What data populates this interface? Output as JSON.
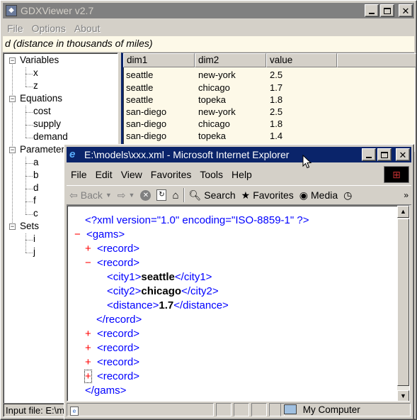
{
  "gdx": {
    "title": "GDXViewer v2.7",
    "menu": [
      "File",
      "Options",
      "About"
    ],
    "symbol_text": "d (distance in thousands of miles)",
    "tree": {
      "groups": [
        {
          "label": "Variables",
          "items": [
            "x",
            "z"
          ]
        },
        {
          "label": "Equations",
          "items": [
            "cost",
            "supply",
            "demand"
          ]
        },
        {
          "label": "Parameters",
          "items": [
            "a",
            "b",
            "d",
            "f",
            "c"
          ]
        },
        {
          "label": "Sets",
          "items": [
            "i",
            "j"
          ]
        }
      ],
      "box_expanded": "−"
    },
    "grid": {
      "headers": [
        "dim1",
        "dim2",
        "value"
      ],
      "rows": [
        [
          "seattle",
          "new-york",
          "2.5"
        ],
        [
          "seattle",
          "chicago",
          "1.7"
        ],
        [
          "seattle",
          "topeka",
          "1.8"
        ],
        [
          "san-diego",
          "new-york",
          "2.5"
        ],
        [
          "san-diego",
          "chicago",
          "1.8"
        ],
        [
          "san-diego",
          "topeka",
          "1.4"
        ]
      ]
    },
    "status_input": "Input file: E:\\m"
  },
  "ie": {
    "title": "E:\\models\\xxx.xml - Microsoft Internet Explorer",
    "menu": [
      "File",
      "Edit",
      "View",
      "Favorites",
      "Tools",
      "Help"
    ],
    "toolbar": {
      "back": "Back",
      "search": "Search",
      "favorites": "Favorites",
      "media": "Media"
    },
    "xml": {
      "decl": "<?xml version=\"1.0\" encoding=\"ISO-8859-1\" ?>",
      "gams_open": "<gams>",
      "record_open": "<record>",
      "city1_open": "<city1>",
      "city1_value": "seattle",
      "city1_close": "</city1>",
      "city2_open": "<city2>",
      "city2_value": "chicago",
      "city2_close": "</city2>",
      "dist_open": "<distance>",
      "dist_value": "1.7",
      "dist_close": "</distance>",
      "record_close": "</record>",
      "gams_close": "</gams>",
      "plus": "+",
      "minus": "−"
    },
    "status_zone": "My Computer"
  },
  "colors": {
    "active_title": "#0a246a",
    "inactive_title": "#808080",
    "xml_markup": "#0000ff",
    "xml_tag": "#990000",
    "xml_toggle": "#ff0000"
  }
}
